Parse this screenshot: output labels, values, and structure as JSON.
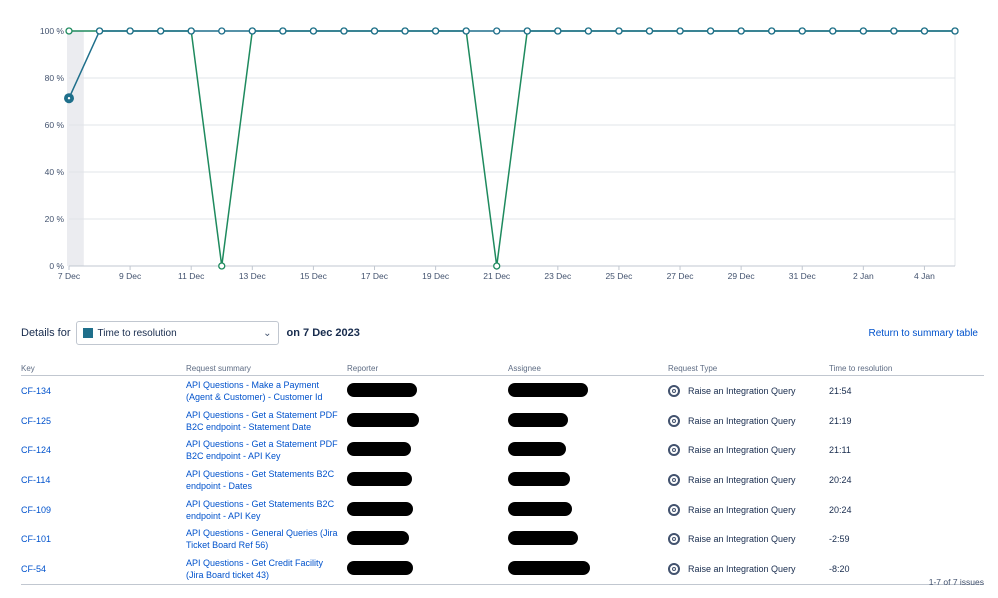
{
  "chart_data": {
    "type": "line",
    "x_tick_labels": [
      "7 Dec",
      "9 Dec",
      "11 Dec",
      "13 Dec",
      "15 Dec",
      "17 Dec",
      "19 Dec",
      "21 Dec",
      "23 Dec",
      "25 Dec",
      "27 Dec",
      "29 Dec",
      "31 Dec",
      "2 Jan",
      "4 Jan"
    ],
    "y_tick_labels": [
      "0 %",
      "20 %",
      "40 %",
      "60 %",
      "80 %",
      "100 %"
    ],
    "ylim": [
      0,
      100
    ],
    "x": [
      "7 Dec",
      "8 Dec",
      "9 Dec",
      "10 Dec",
      "11 Dec",
      "12 Dec",
      "13 Dec",
      "14 Dec",
      "15 Dec",
      "16 Dec",
      "17 Dec",
      "18 Dec",
      "19 Dec",
      "20 Dec",
      "21 Dec",
      "22 Dec",
      "23 Dec",
      "24 Dec",
      "25 Dec",
      "26 Dec",
      "27 Dec",
      "28 Dec",
      "29 Dec",
      "30 Dec",
      "31 Dec",
      "1 Jan",
      "2 Jan",
      "3 Jan",
      "4 Jan",
      "5 Jan"
    ],
    "series": [
      {
        "color": "#1f6f8b",
        "values": [
          71.4,
          100,
          100,
          100,
          100,
          100,
          100,
          100,
          100,
          100,
          100,
          100,
          100,
          100,
          100,
          100,
          100,
          100,
          100,
          100,
          100,
          100,
          100,
          100,
          100,
          100,
          100,
          100,
          100,
          100
        ]
      },
      {
        "color": "#1e8a5e",
        "values": [
          100,
          100,
          100,
          100,
          100,
          0,
          100,
          100,
          100,
          100,
          100,
          100,
          100,
          100,
          0,
          100,
          100,
          100,
          100,
          100,
          100,
          100,
          100,
          100,
          100,
          100,
          100,
          100,
          100,
          100
        ]
      }
    ],
    "highlighted_x": "7 Dec",
    "grid": true
  },
  "details": {
    "label": "Details for",
    "metric": "Time to resolution",
    "metric_color": "#1f6f8b",
    "date_text": "on 7 Dec 2023",
    "return_link": "Return to summary table"
  },
  "table": {
    "headers": {
      "key": "Key",
      "summary": "Request summary",
      "reporter": "Reporter",
      "assignee": "Assignee",
      "type": "Request Type",
      "ttr": "Time to resolution"
    },
    "rows": [
      {
        "key": "CF-134",
        "summary": "API Questions - Make a Payment (Agent & Customer) - Customer Id",
        "type": "Raise an Integration Query",
        "ttr": "21:54"
      },
      {
        "key": "CF-125",
        "summary": "API Questions - Get a Statement PDF B2C endpoint - Statement Date",
        "type": "Raise an Integration Query",
        "ttr": "21:19"
      },
      {
        "key": "CF-124",
        "summary": "API Questions - Get a Statement PDF B2C endpoint - API Key",
        "type": "Raise an Integration Query",
        "ttr": "21:11"
      },
      {
        "key": "CF-114",
        "summary": "API Questions - Get Statements B2C endpoint - Dates",
        "type": "Raise an Integration Query",
        "ttr": "20:24"
      },
      {
        "key": "CF-109",
        "summary": "API Questions - Get Statements B2C endpoint - API Key",
        "type": "Raise an Integration Query",
        "ttr": "20:24"
      },
      {
        "key": "CF-101",
        "summary": "API Questions - General Queries (Jira Ticket Board Ref 56)",
        "type": "Raise an Integration Query",
        "ttr": "-2:59"
      },
      {
        "key": "CF-54",
        "summary": "API Questions - Get Credit Facility (Jira Board ticket 43)",
        "type": "Raise an Integration Query",
        "ttr": "-8:20"
      }
    ],
    "pagination": "1-7 of 7 issues"
  },
  "icons": {
    "request_type": "lifebuoy-icon",
    "dropdown": "chevron-down-icon"
  }
}
